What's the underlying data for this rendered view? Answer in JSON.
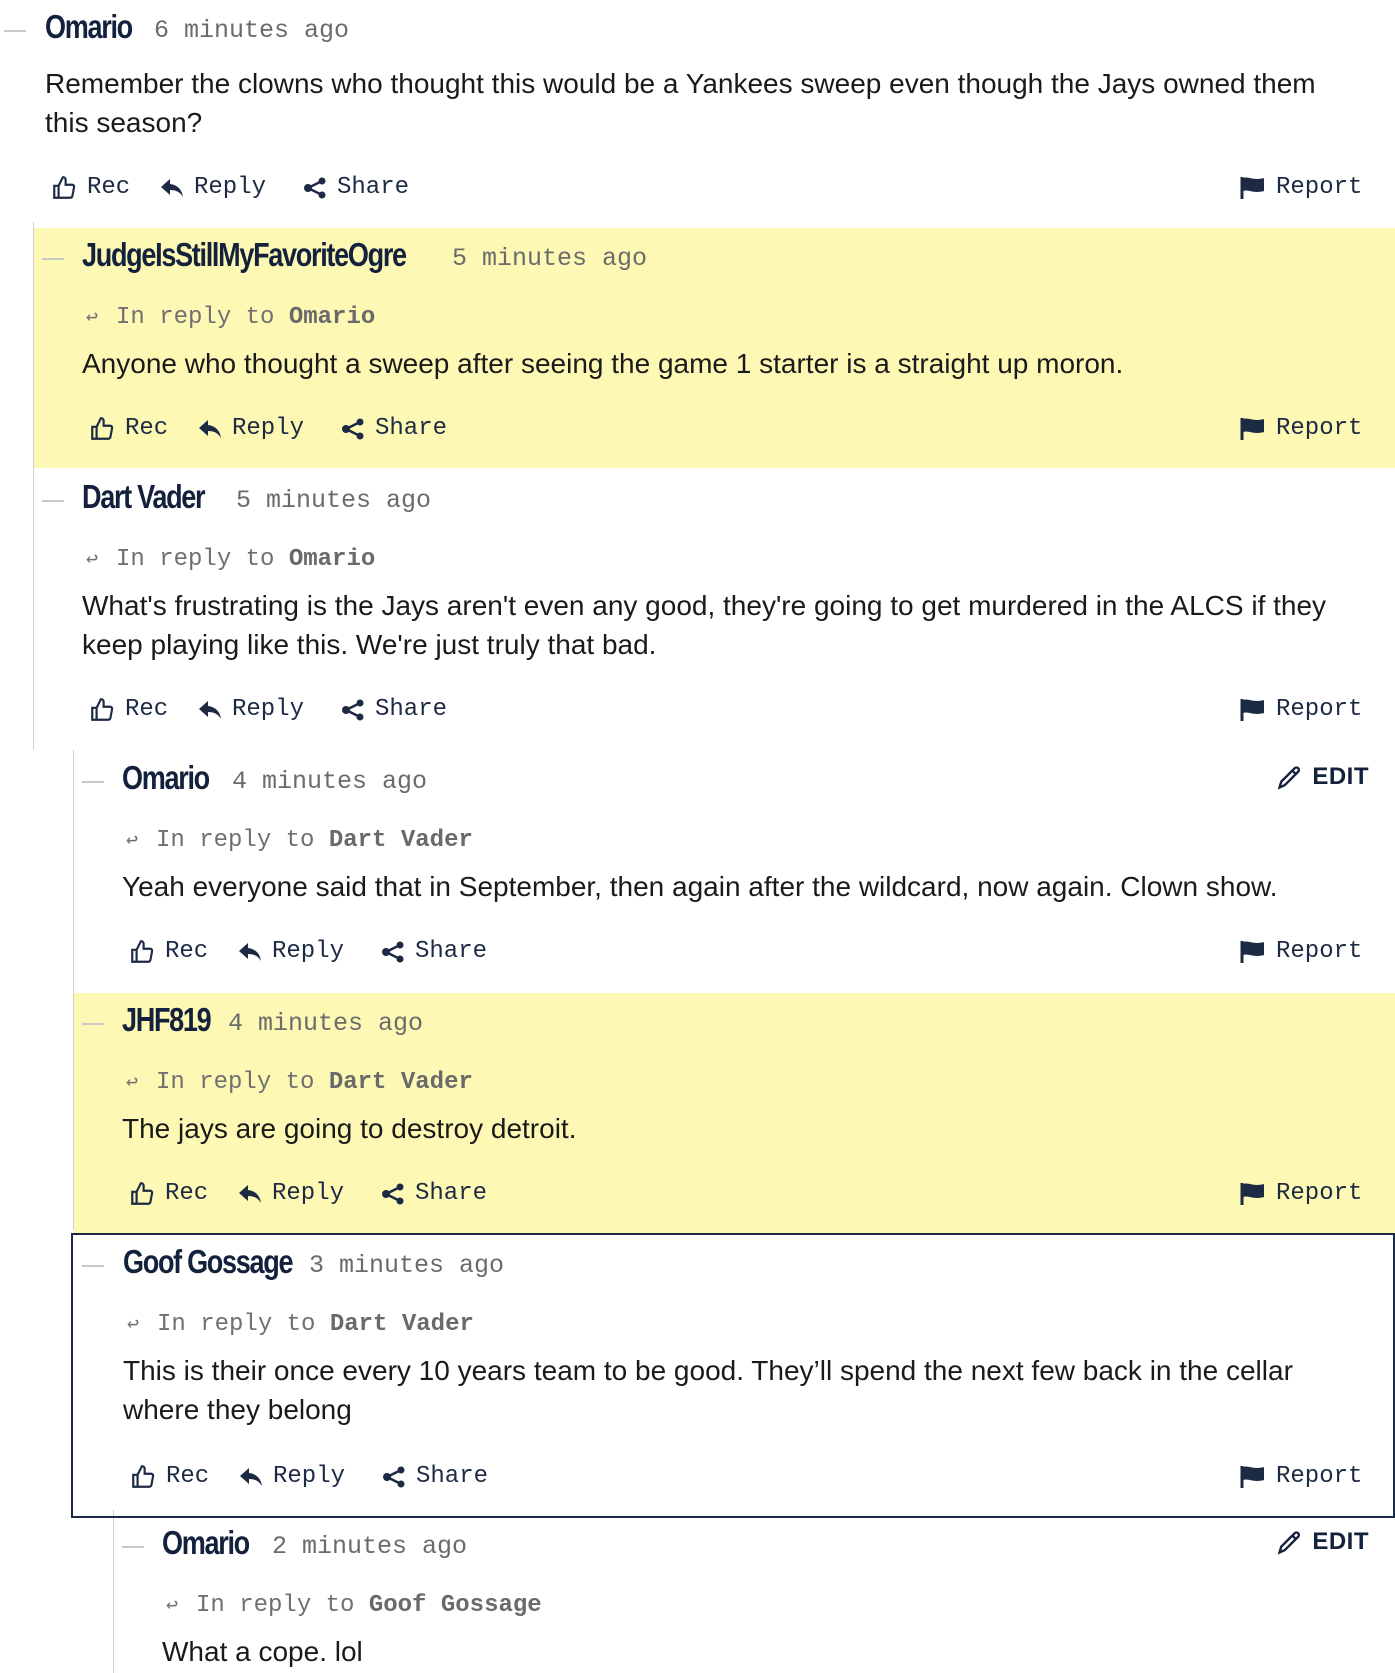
{
  "actions": {
    "rec": "Rec",
    "reply": "Reply",
    "share": "Share",
    "report": "Report",
    "edit": "EDIT",
    "in_reply_to": "In reply to"
  },
  "comments": [
    {
      "author": "Omario",
      "time": "6 minutes ago",
      "in_reply_to": "",
      "body": "Remember the clowns who thought this would be a Yankees sweep even though the Jays owned them this season?",
      "highlighted": false,
      "editable": false
    },
    {
      "author": "JudgeIsStillMyFavoriteOgre",
      "time": "5 minutes ago",
      "in_reply_to": "Omario",
      "body": "Anyone who thought a sweep after seeing the game 1 starter is a straight up moron.",
      "highlighted": true,
      "editable": false
    },
    {
      "author": "Dart Vader",
      "time": "5 minutes ago",
      "in_reply_to": "Omario",
      "body": "What's frustrating is the Jays aren't even any good, they're going to get murdered in the ALCS if they keep playing like this. We're just truly that bad.",
      "highlighted": false,
      "editable": false
    },
    {
      "author": "Omario",
      "time": "4 minutes ago",
      "in_reply_to": "Dart Vader",
      "body": "Yeah everyone said that in September, then again after the wildcard, now again. Clown show.",
      "highlighted": false,
      "editable": true
    },
    {
      "author": "JHF819",
      "time": "4 minutes ago",
      "in_reply_to": "Dart Vader",
      "body": "The jays are going to destroy detroit.",
      "highlighted": true,
      "editable": false
    },
    {
      "author": "Goof Gossage",
      "time": "3 minutes ago",
      "in_reply_to": "Dart Vader",
      "body": "This is their once every 10 years team to be good. They’ll spend the next few back in the cellar where they belong",
      "highlighted": false,
      "editable": false,
      "focused": true
    },
    {
      "author": "Omario",
      "time": "2 minutes ago",
      "in_reply_to": "Goof Gossage",
      "body": "What a cope. lol",
      "highlighted": false,
      "editable": true
    }
  ]
}
